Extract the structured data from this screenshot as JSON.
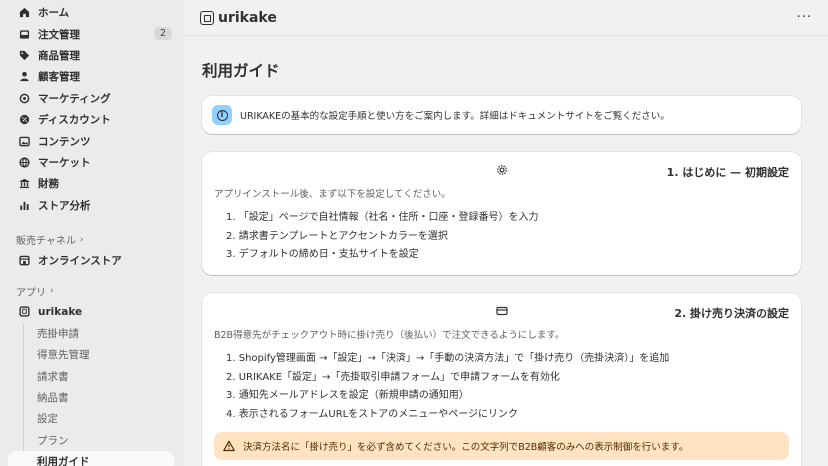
{
  "sidebar": {
    "items": [
      {
        "icon": "home-icon",
        "label": "ホーム"
      },
      {
        "icon": "inbox-icon",
        "label": "注文管理",
        "badge": "2"
      },
      {
        "icon": "tag-icon",
        "label": "商品管理"
      },
      {
        "icon": "person-icon",
        "label": "顧客管理"
      },
      {
        "icon": "target-icon",
        "label": "マーケティング"
      },
      {
        "icon": "discount-icon",
        "label": "ディスカウント"
      },
      {
        "icon": "content-icon",
        "label": "コンテンツ"
      },
      {
        "icon": "globe-icon",
        "label": "マーケット"
      },
      {
        "icon": "bank-icon",
        "label": "財務"
      },
      {
        "icon": "chart-icon",
        "label": "ストア分析"
      }
    ],
    "sales_channels": {
      "heading": "販売チャネル",
      "items": [
        {
          "icon": "store-icon",
          "label": "オンラインストア"
        }
      ]
    },
    "apps": {
      "heading": "アプリ",
      "app": {
        "icon": "app-icon",
        "label": "urikake"
      },
      "sub_items": [
        "売掛申請",
        "得意先管理",
        "請求書",
        "納品書",
        "設定",
        "プラン",
        "利用ガイド"
      ],
      "active": "利用ガイド"
    }
  },
  "header": {
    "app_name": "urikake",
    "more": "···"
  },
  "page": {
    "title": "利用ガイド",
    "banner": "URIKAKEの基本的な設定手順と使い方をご案内します。詳細はドキュメントサイトをご覧ください。",
    "sections": [
      {
        "icon": "gear-icon",
        "title": "1. はじめに — 初期設定",
        "intro": "アプリインストール後、まず以下を設定してください。",
        "steps": [
          "1. 「設定」ページで自社情報（社名・住所・口座・登録番号）を入力",
          "2. 請求書テンプレートとアクセントカラーを選択",
          "3. デフォルトの締め日・支払サイトを設定"
        ]
      },
      {
        "icon": "credit-card-icon",
        "title": "2. 掛け売り決済の設定",
        "intro": "B2B得意先がチェックアウト時に掛け売り（後払い）で注文できるようにします。",
        "steps": [
          "1. Shopify管理画面 →「設定」→「決済」→「手動の決済方法」で「掛け売り（売掛決済）」を追加",
          "2. URIKAKE「設定」→「売掛取引申請フォーム」で申請フォームを有効化",
          "3. 通知先メールアドレスを設定（新規申請の通知用）",
          "4. 表示されるフォームURLをストアのメニューやページにリンク"
        ],
        "warning": "決済方法名に「掛け売り」を必ず含めてください。この文字列でB2B顧客のみへの表示制御を行います。"
      }
    ]
  },
  "colors": {
    "info": "#91d0ff",
    "warning_bg": "#ffe3c2",
    "sidebar_bg": "#ebebeb",
    "page_bg": "#f1f1f1"
  }
}
